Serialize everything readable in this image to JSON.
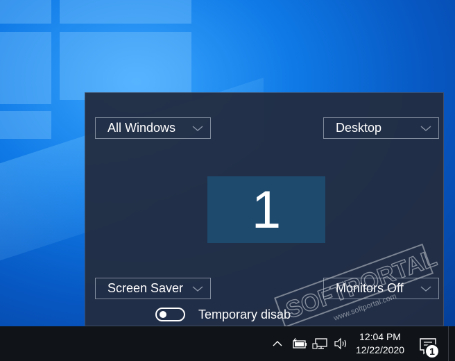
{
  "panel": {
    "corners": {
      "top_left": "All Windows",
      "top_right": "Desktop",
      "bottom_left": "Screen Saver",
      "bottom_right": "Monitors Off"
    },
    "monitor_number": "1",
    "toggle_label": "Temporary disab",
    "toggle_on": false
  },
  "watermark": {
    "brand": "SOFTPORTAL",
    "trademark": "TM",
    "url": "www.softportal.com"
  },
  "taskbar": {
    "time": "12:04 PM",
    "date": "12/22/2020",
    "notification_count": "1",
    "icons": [
      "chevron-up-icon",
      "battery-icon",
      "network-icon",
      "volume-icon",
      "notification-icon"
    ]
  },
  "colors": {
    "panel_bg": "#222d42",
    "monitor_bg": "#1e4a6e",
    "taskbar_bg": "#101418",
    "wallpaper_accent": "#0a5fc4"
  }
}
